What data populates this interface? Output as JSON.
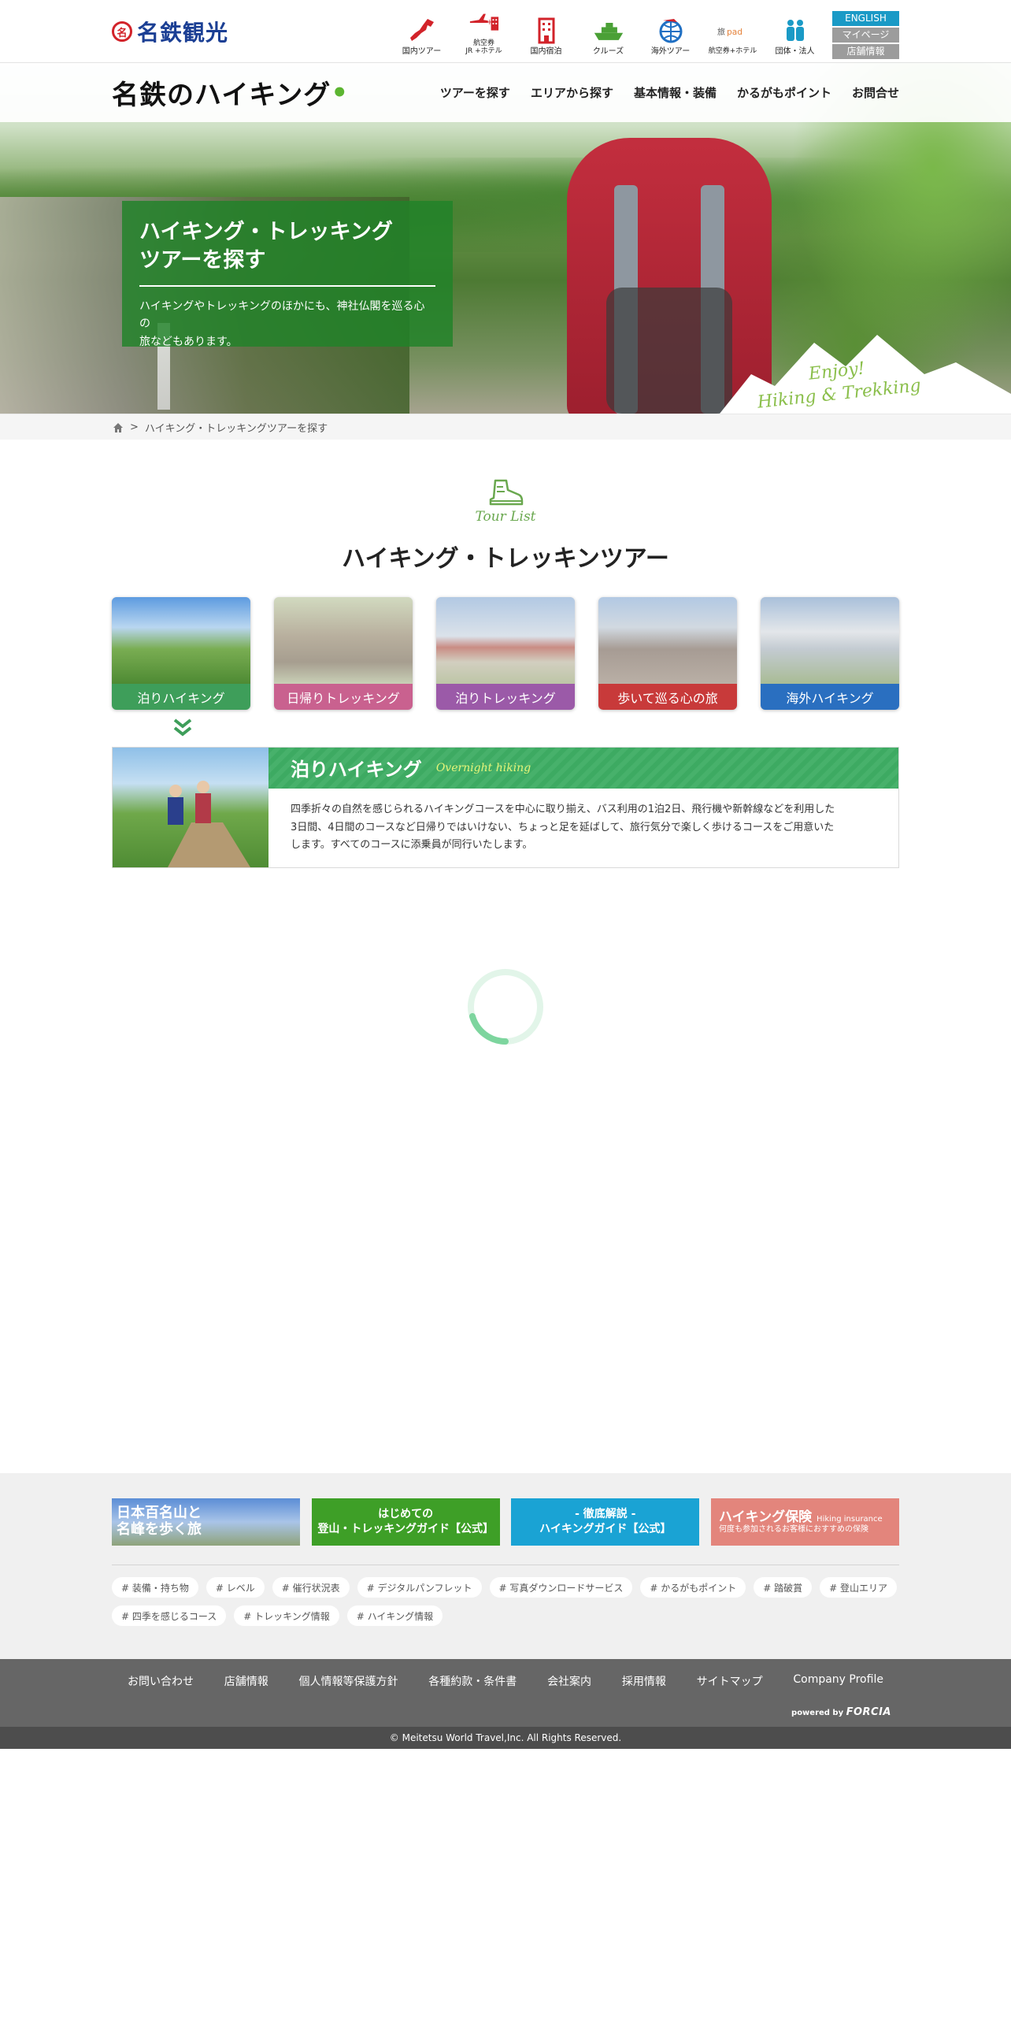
{
  "brand": {
    "name": "名鉄観光",
    "mark": "名"
  },
  "topnav": [
    {
      "label": "国内ツアー",
      "icon": "japan-map-icon",
      "color": "#d2232a"
    },
    {
      "label": "航空券\nJR +ホテル",
      "icon": "plane-hotel-icon",
      "color": "#d2232a"
    },
    {
      "label": "国内宿泊",
      "icon": "building-icon",
      "color": "#d2232a"
    },
    {
      "label": "クルーズ",
      "icon": "ship-icon",
      "color": "#4aa036"
    },
    {
      "label": "海外ツアー",
      "icon": "globe-icon",
      "color": "#1f6fc3"
    },
    {
      "label": "航空券+ホテル",
      "icon": "tabipad-icon",
      "color": "#e5823a"
    },
    {
      "label": "団体・法人",
      "icon": "group-icon",
      "color": "#1a9ac6"
    }
  ],
  "lang": {
    "english": "ENGLISH",
    "mypage": "マイページ",
    "store": "店舗情報"
  },
  "hikeLogo": "名鉄のハイキング",
  "mainnav": [
    "ツアーを探す",
    "エリアから探す",
    "基本情報・装備",
    "かるがもポイント",
    "お問合せ"
  ],
  "hero": {
    "title_line1": "ハイキング・トレッキング",
    "title_line2": "ツアーを探す",
    "desc_line1": "ハイキングやトレッキングのほかにも、神社仏閣を巡る心の",
    "desc_line2": "旅などもあります。",
    "enjoy_line1": "Enjoy!",
    "enjoy_line2": "Hiking & Trekking"
  },
  "breadcrumb": {
    "current": "ハイキング・トレッキングツアーを探す",
    "sep": ">"
  },
  "tourlist": {
    "sub": "Tour List",
    "title": "ハイキング・トレッキンツアー"
  },
  "categories": [
    {
      "label": "泊りハイキング",
      "color": "#3e9e5a",
      "active": true
    },
    {
      "label": "日帰りトレッキング",
      "color": "#c9618f",
      "active": false
    },
    {
      "label": "泊りトレッキング",
      "color": "#9b5aa8",
      "active": false
    },
    {
      "label": "歩いて巡る心の旅",
      "color": "#c83a3a",
      "active": false
    },
    {
      "label": "海外ハイキング",
      "color": "#2a6fc0",
      "active": false
    }
  ],
  "detail": {
    "title": "泊りハイキング",
    "sub": "Overnight hiking",
    "line1": "四季折々の自然を感じられるハイキングコースを中心に取り揃え、バス利用の1泊2日、飛行機や新幹線などを利用した",
    "line2": "3日間、4日間のコースなど日帰りではいけない、ちょっと足を延ばして、旅行気分で楽しく歩けるコースをご用意いた",
    "line3": "します。すべてのコースに添乗員が同行いたします。"
  },
  "banners": {
    "b1_line1": "日本百名山と",
    "b1_line2": "名峰を歩く旅",
    "b2_line1": "はじめての",
    "b2_line2": "登山・トレッキングガイド【公式】",
    "b3_line1": "- 徹底解説 -",
    "b3_line2": "ハイキングガイド【公式】",
    "b4_line1": "ハイキング保険",
    "b4_en": "Hiking insurance",
    "b4_line2": "何度も参加されるお客様におすすめの保険"
  },
  "tags": [
    "# 装備・持ち物",
    "# レベル",
    "# 催行状況表",
    "# デジタルパンフレット",
    "# 写真ダウンロードサービス",
    "# かるがもポイント",
    "# 踏破賞",
    "# 登山エリア",
    "# 四季を感じるコース",
    "# トレッキング情報",
    "# ハイキング情報"
  ],
  "footerNav": [
    "お問い合わせ",
    "店舗情報",
    "個人情報等保護方針",
    "各種約款・条件書",
    "会社案内",
    "採用情報",
    "サイトマップ",
    "Company Profile"
  ],
  "powered": {
    "prefix": "powered by",
    "brand": "FORCIA"
  },
  "copyright": "© Meitetsu World Travel,Inc. All Rights Reserved."
}
